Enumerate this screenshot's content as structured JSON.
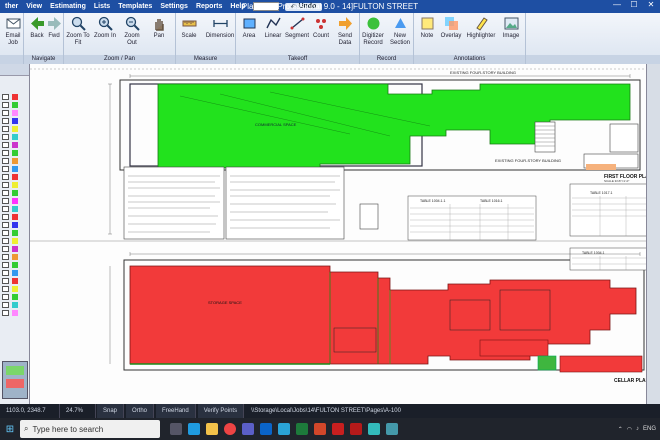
{
  "titlebar": {
    "menus": [
      "ther",
      "View",
      "Estimating",
      "Lists",
      "Templates",
      "Settings",
      "Reports",
      "Help"
    ],
    "undo_label": "Undo",
    "title": "PlanSwift Professional 9.0 - 14]FULTON STREET"
  },
  "ribbon": {
    "groups": [
      {
        "label": "",
        "buttons": [
          "Email Job"
        ]
      },
      {
        "label": "Navigate",
        "buttons": [
          "Back",
          "Fwd"
        ]
      },
      {
        "label": "Zoom / Pan",
        "buttons": [
          "Zoom To Fit",
          "Zoom In",
          "Zoom Out",
          "Pan"
        ]
      },
      {
        "label": "Measure",
        "buttons": [
          "Scale",
          "Dimension"
        ]
      },
      {
        "label": "Takeoff",
        "buttons": [
          "Area",
          "Linear",
          "Segment",
          "Count",
          "Send Data"
        ]
      },
      {
        "label": "Record",
        "buttons": [
          "Digitizer Record",
          "New Section"
        ]
      },
      {
        "label": "Annotations",
        "buttons": [
          "Note",
          "Overlay",
          "Highlighter",
          "Image"
        ]
      }
    ]
  },
  "plan": {
    "label_first_floor": "FIRST FLOOR PLAN",
    "label_scale": "SCALE 3/16\"=1'-0\"",
    "label_cellar": "CELLAR PLAN",
    "existing_bldg": "EXISTING FOUR-STORY BUILDING",
    "area_upper": "COMMERCIAL SPACE",
    "area_lower": "STORAGE SPACE",
    "table1_title": "TABLE 1004.1.1",
    "table2_title": "TABLE 1016.1",
    "table3_title": "TABLE 1017.1",
    "table4_title": "TABLE 1004.1"
  },
  "status": {
    "coords": "1103.0, 2348.7",
    "zoom": "24.7%",
    "snap": "Snap",
    "ortho": "Ortho",
    "freehand": "FreeHand",
    "vertify": "Verify Points",
    "path": "\\\\Storage\\Local\\Jobs\\14\\FULTON STREET\\Pages\\A-100"
  },
  "taskbar": {
    "search_placeholder": "Type here to search",
    "lang": "ENG"
  },
  "colors": {
    "green_area": "#22e21d",
    "red_area": "#f23a3a",
    "ribbon_blue": "#1e4fa3"
  }
}
